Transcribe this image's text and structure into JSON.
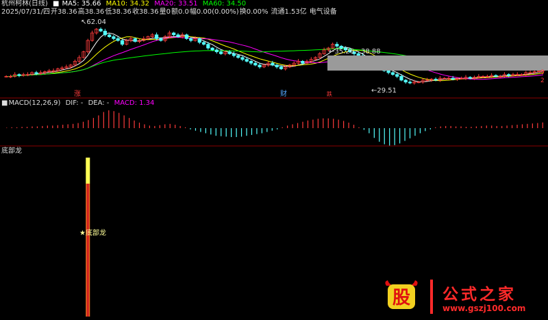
{
  "colors": {
    "up": "#ff3b3b",
    "down": "#54ffff",
    "ma5": "#ffffff",
    "ma10": "#ffff00",
    "ma20": "#ff00ff",
    "ma60": "#00ff00",
    "divider": "#8b0000",
    "macd_label": "#ff00ff",
    "bar_red": "#d02020",
    "bar_yellow": "#ffff55",
    "star_text": "#ffff99",
    "box": "#9a9a9a"
  },
  "header": {
    "title": "杭州柯林(日线)",
    "ma5": "MA5: 35.66",
    "ma10": "MA10: 34.32",
    "ma20": "MA20: 33.51",
    "ma60": "MA60: 34.50",
    "quote": {
      "date": "2025/07/31/四",
      "open": "开38.36",
      "high": "高38.36",
      "low": "低38.36",
      "close": "收38.36",
      "volume": "量0",
      "amount": "额0.0",
      "change": "幅0.00(0.00%)",
      "turnover": "换0.00%",
      "float": "流通1.53亿",
      "sector": "电气设备"
    }
  },
  "price_panel": {
    "peak_label": "62.04",
    "low_label": "29.51",
    "range_label": "35.26 - 38.88",
    "markers": [
      "涨",
      "财",
      "跌"
    ],
    "right_marks": [
      "0",
      "2"
    ]
  },
  "macd_panel": {
    "name": "MACD(12,26,9)",
    "dif": "DIF: -",
    "dea": "DEA: -",
    "macd": "MACD: 1.34"
  },
  "indicator_panel": {
    "name": "底部龙",
    "signal_label": "★底部龙"
  },
  "watermark": {
    "icon_text": "股",
    "brand": "公式之家",
    "url": "www.gszj100.com"
  },
  "chart_data": [
    {
      "type": "candlestick",
      "title": "杭州柯林(日线)",
      "series_names": [
        "MA5",
        "MA10",
        "MA20",
        "MA60"
      ],
      "last_ma": {
        "MA5": 35.66,
        "MA10": 34.32,
        "MA20": 33.51,
        "MA60": 34.5
      },
      "annotations": {
        "high": 62.04,
        "low": 29.51,
        "range": [
          35.26,
          38.88
        ]
      },
      "closes": [
        33,
        33,
        34,
        33.5,
        34,
        34,
        35,
        34.5,
        35,
        35.5,
        36,
        36,
        37,
        37.5,
        38,
        39,
        41,
        43,
        46,
        52,
        56,
        58,
        57,
        55,
        54,
        53,
        52,
        50,
        52,
        53,
        51.5,
        52,
        53,
        54,
        55,
        53,
        52,
        54,
        56,
        55,
        54,
        55,
        53,
        52,
        53,
        51,
        50,
        48,
        47,
        46,
        45,
        46,
        45,
        44,
        43,
        42,
        41,
        40,
        39,
        38,
        39,
        40,
        39,
        38,
        37,
        38,
        39,
        40,
        41,
        40,
        41,
        42,
        43,
        45,
        47,
        48,
        50,
        49,
        48,
        47,
        46,
        45,
        44,
        42,
        40,
        39,
        38,
        37,
        36,
        35,
        34,
        33,
        31,
        30,
        29.51,
        30,
        30,
        31,
        31,
        31.5,
        31,
        32,
        32,
        32,
        31.5,
        32,
        32,
        32.5,
        32,
        32.5,
        33,
        33,
        33,
        33.5,
        33,
        33,
        34,
        33.5,
        34,
        34,
        34,
        35,
        35,
        35.5,
        36,
        38.36
      ]
    },
    {
      "type": "bar",
      "title": "MACD(12,26,9)",
      "series_names": [
        "MACD"
      ],
      "last_value": 1.34,
      "values": [
        0.1,
        0.2,
        0.2,
        0.3,
        0.3,
        0.4,
        0.4,
        0.5,
        0.6,
        0.6,
        0.7,
        0.8,
        0.9,
        1.0,
        1.2,
        1.5,
        1.9,
        2.4,
        3.0,
        3.8,
        4.2,
        4.0,
        3.6,
        3.0,
        2.4,
        1.8,
        1.3,
        0.9,
        0.6,
        0.5,
        0.7,
        0.9,
        1.0,
        0.8,
        0.5,
        0.2,
        -0.3,
        -0.6,
        -0.9,
        -1.2,
        -1.5,
        -1.8,
        -1.9,
        -2.0,
        -2.1,
        -2.1,
        -2.0,
        -1.8,
        -1.6,
        -1.4,
        -1.2,
        -0.9,
        -0.6,
        -0.3,
        0.2,
        0.6,
        0.9,
        1.2,
        1.5,
        1.8,
        2.0,
        2.2,
        2.3,
        2.3,
        2.2,
        2.0,
        1.7,
        1.3,
        0.8,
        0.2,
        -0.4,
        -1.2,
        -2.3,
        -3.2,
        -3.8,
        -4.1,
        -4.0,
        -3.6,
        -3.0,
        -2.4,
        -1.8,
        -1.2,
        -0.7,
        -0.3,
        0.2,
        0.4,
        0.5,
        0.5,
        0.4,
        0.4,
        0.3,
        0.3,
        0.4,
        0.5,
        0.6,
        0.6,
        0.5,
        0.5,
        0.6,
        0.7,
        0.8,
        0.9,
        1.0,
        1.1,
        1.2,
        1.34
      ]
    },
    {
      "type": "bar",
      "title": "底部龙",
      "signal_index": 19,
      "signal_value": 1
    }
  ]
}
